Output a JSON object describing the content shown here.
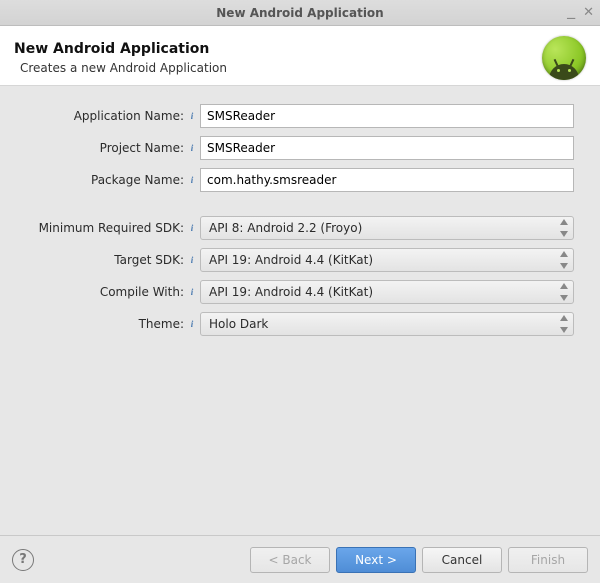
{
  "window": {
    "title": "New Android Application"
  },
  "header": {
    "title": "New Android Application",
    "subtitle": "Creates a new Android Application"
  },
  "fields": {
    "app_name": {
      "label": "Application Name:",
      "value": "SMSReader"
    },
    "project_name": {
      "label": "Project Name:",
      "value": "SMSReader"
    },
    "package_name": {
      "label": "Package Name:",
      "value": "com.hathy.smsreader"
    },
    "min_sdk": {
      "label": "Minimum Required SDK:",
      "value": "API 8: Android 2.2 (Froyo)"
    },
    "target_sdk": {
      "label": "Target SDK:",
      "value": "API 19: Android 4.4 (KitKat)"
    },
    "compile_with": {
      "label": "Compile With:",
      "value": "API 19: Android 4.4 (KitKat)"
    },
    "theme": {
      "label": "Theme:",
      "value": "Holo Dark"
    }
  },
  "buttons": {
    "back": "< Back",
    "next": "Next >",
    "cancel": "Cancel",
    "finish": "Finish",
    "help": "?"
  }
}
